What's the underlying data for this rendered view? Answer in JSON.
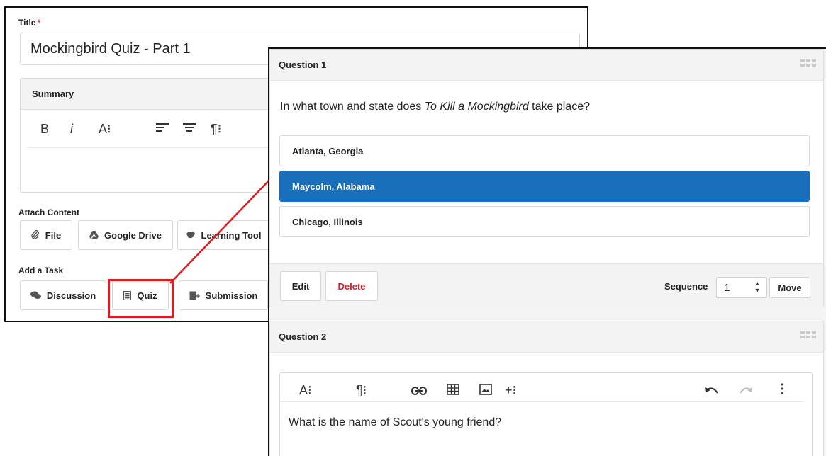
{
  "task_form": {
    "title_label": "Title",
    "required_mark": "*",
    "title_value": "Mockingbird Quiz - Part 1",
    "summary_label": "Summary",
    "toolbar": {
      "bold": "B",
      "italic": "i",
      "font_size": "A⁝",
      "align_left": "☰",
      "align_center": "☰",
      "paragraph": "¶⁝"
    },
    "attach_label": "Attach Content",
    "attach_buttons": [
      {
        "label": "File",
        "icon": "paperclip-icon"
      },
      {
        "label": "Google Drive",
        "icon": "google-drive-icon"
      },
      {
        "label": "Learning Tool",
        "icon": "puzzle-icon"
      }
    ],
    "task_label": "Add a Task",
    "task_buttons": [
      {
        "label": "Discussion",
        "icon": "chat-icon"
      },
      {
        "label": "Quiz",
        "icon": "quiz-icon"
      },
      {
        "label": "Submission",
        "icon": "submission-icon"
      }
    ]
  },
  "questions": [
    {
      "header": "Question 1",
      "text_before": "In what town and state does ",
      "text_italic": "To Kill a Mockingbird",
      "text_after": " take place?",
      "answers": [
        "Atlanta, Georgia",
        "Maycolm, Alabama",
        "Chicago, Illinois"
      ],
      "selected_index": 1,
      "edit_label": "Edit",
      "delete_label": "Delete",
      "sequence_label": "Sequence",
      "sequence_value": "1",
      "move_label": "Move"
    },
    {
      "header": "Question 2",
      "text": "What is the name of Scout's young friend?"
    }
  ],
  "colors": {
    "selected_answer": "#1a6fba",
    "delete_text": "#d0202a",
    "highlight": "#e0191f"
  }
}
